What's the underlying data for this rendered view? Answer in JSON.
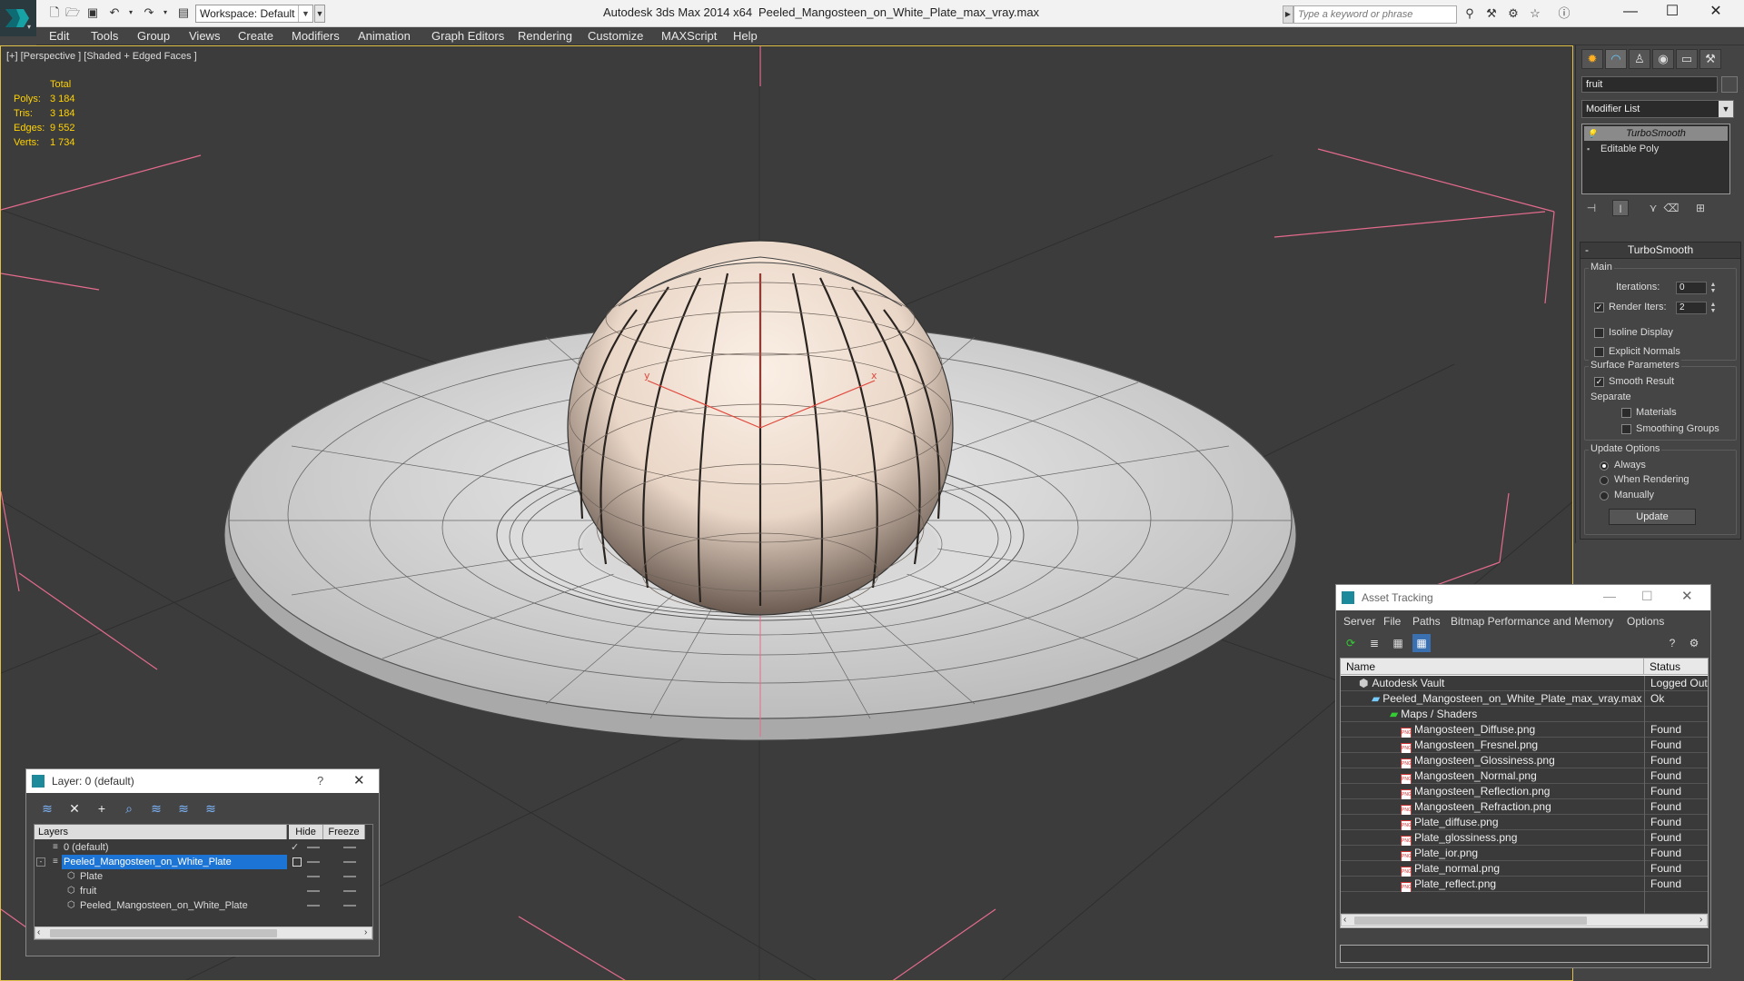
{
  "titlebar": {
    "app": "Autodesk 3ds Max  2014 x64",
    "file": "Peeled_Mangosteen_on_White_Plate_max_vray.max",
    "workspace": "Workspace: Default",
    "search_placeholder": "Type a keyword or phrase"
  },
  "menus": [
    "Edit",
    "Tools",
    "Group",
    "Views",
    "Create",
    "Modifiers",
    "Animation",
    "Graph Editors",
    "Rendering",
    "Customize",
    "MAXScript",
    "Help"
  ],
  "viewport": {
    "label": "[+] [Perspective ] [Shaded + Edged Faces ]",
    "stats": {
      "header": "Total",
      "rows": [
        {
          "k": "Polys:",
          "v": "3 184"
        },
        {
          "k": "Tris:",
          "v": "3 184"
        },
        {
          "k": "Edges:",
          "v": "9 552"
        },
        {
          "k": "Verts:",
          "v": "1 734"
        }
      ]
    },
    "axis_x": "x",
    "axis_y": "y"
  },
  "command_panel": {
    "object_name": "fruit",
    "modifier_list": "Modifier List",
    "stack": [
      "TurboSmooth",
      "Editable Poly"
    ],
    "rollout_title": "TurboSmooth",
    "main": "Main",
    "iterations_label": "Iterations:",
    "iterations": "0",
    "render_iters_label": "Render Iters:",
    "render_iters": "2",
    "isoline": "Isoline Display",
    "explicit_normals": "Explicit Normals",
    "surface_params": "Surface Parameters",
    "smooth_result": "Smooth Result",
    "separate": "Separate",
    "materials": "Materials",
    "smoothing_groups": "Smoothing Groups",
    "update_options": "Update Options",
    "always": "Always",
    "when_rendering": "When Rendering",
    "manually": "Manually",
    "update_btn": "Update"
  },
  "layer_window": {
    "title": "Layer: 0 (default)",
    "help": "?",
    "columns": [
      "Layers",
      "Hide",
      "Freeze"
    ],
    "rows": [
      {
        "name": "0 (default)"
      },
      {
        "name": "Peeled_Mangosteen_on_White_Plate"
      },
      {
        "name": "Plate"
      },
      {
        "name": "fruit"
      },
      {
        "name": "Peeled_Mangosteen_on_White_Plate"
      }
    ]
  },
  "asset_window": {
    "title": "Asset Tracking",
    "menus": [
      "Server",
      "File",
      "Paths",
      "Bitmap Performance and Memory",
      "Options"
    ],
    "columns": [
      "Name",
      "Status"
    ],
    "rows": [
      {
        "name": "Autodesk Vault",
        "status": "Logged Out"
      },
      {
        "name": "Peeled_Mangosteen_on_White_Plate_max_vray.max",
        "status": "Ok"
      },
      {
        "name": "Maps / Shaders",
        "status": ""
      },
      {
        "name": "Mangosteen_Diffuse.png",
        "status": "Found"
      },
      {
        "name": "Mangosteen_Fresnel.png",
        "status": "Found"
      },
      {
        "name": "Mangosteen_Glossiness.png",
        "status": "Found"
      },
      {
        "name": "Mangosteen_Normal.png",
        "status": "Found"
      },
      {
        "name": "Mangosteen_Reflection.png",
        "status": "Found"
      },
      {
        "name": "Mangosteen_Refraction.png",
        "status": "Found"
      },
      {
        "name": "Plate_diffuse.png",
        "status": "Found"
      },
      {
        "name": "Plate_glossiness.png",
        "status": "Found"
      },
      {
        "name": "Plate_ior.png",
        "status": "Found"
      },
      {
        "name": "Plate_normal.png",
        "status": "Found"
      },
      {
        "name": "Plate_reflect.png",
        "status": "Found"
      }
    ]
  },
  "colors": {
    "selection": "#1c74d4",
    "stats": "#ffd200",
    "viewport_border": "#e0c048"
  }
}
